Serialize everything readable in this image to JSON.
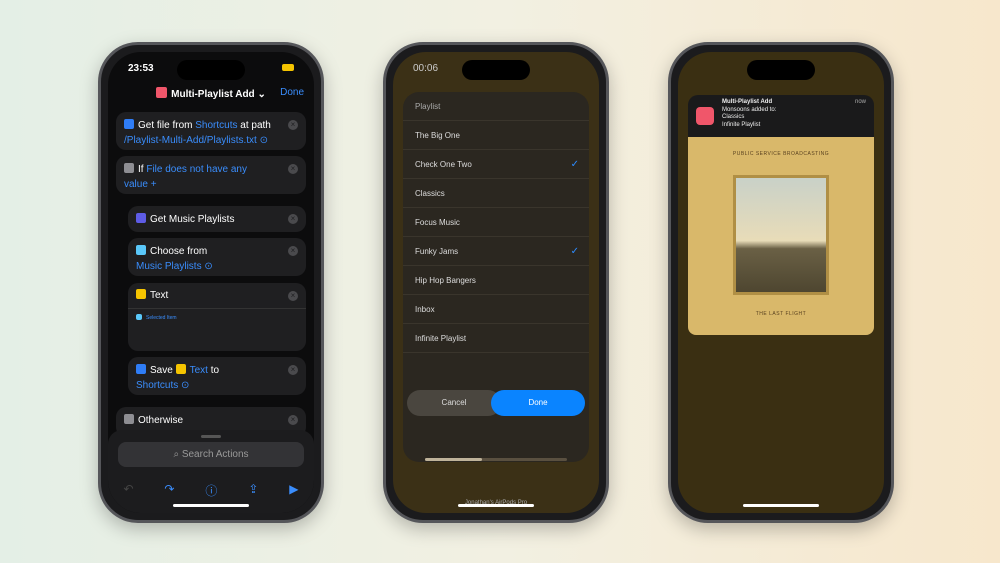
{
  "phone1": {
    "time": "23:53",
    "title": "Multi-Playlist Add",
    "done": "Done",
    "get_file": {
      "verb": "Get file from",
      "source": "Shortcuts",
      "mid": "at path",
      "path": "/Playlist-Multi-Add/Playlists.txt"
    },
    "if": {
      "label": "If",
      "var": "File",
      "cond": "does not have any",
      "cond2": "value",
      "plus": "+"
    },
    "get_playlists": "Get Music Playlists",
    "choose": {
      "label": "Choose from",
      "var": "Music Playlists"
    },
    "text": {
      "label": "Text",
      "var": "Selected Item"
    },
    "save": {
      "verb": "Save",
      "var": "Text",
      "mid": "to",
      "dest": "Shortcuts"
    },
    "otherwise": "Otherwise",
    "search_placeholder": "Search Actions"
  },
  "phone2": {
    "time": "00:06",
    "header": "Playlist",
    "items": [
      {
        "name": "The Big One",
        "checked": false
      },
      {
        "name": "Check One Two",
        "checked": true
      },
      {
        "name": "Classics",
        "checked": false
      },
      {
        "name": "Focus Music",
        "checked": false
      },
      {
        "name": "Funky Jams",
        "checked": true
      },
      {
        "name": "Hip Hop Bangers",
        "checked": false
      },
      {
        "name": "Inbox",
        "checked": false
      },
      {
        "name": "Infinite Playlist",
        "checked": false
      }
    ],
    "cancel": "Cancel",
    "done": "Done",
    "volume": 0.4,
    "device": "Jonathan's AirPods Pro"
  },
  "phone3": {
    "notification": {
      "app": "Multi-Playlist Add",
      "line1": "Monsoons added to:",
      "line2": "Classics",
      "line3": "Infinite Playlist",
      "time": "now"
    },
    "album": {
      "artist": "PUBLIC SERVICE BROADCASTING",
      "title": "THE LAST FLIGHT"
    }
  },
  "colors": {
    "accent": "#3a8dfc",
    "shortcut_icon": "#f0566a",
    "done_button": "#0a84ff"
  }
}
